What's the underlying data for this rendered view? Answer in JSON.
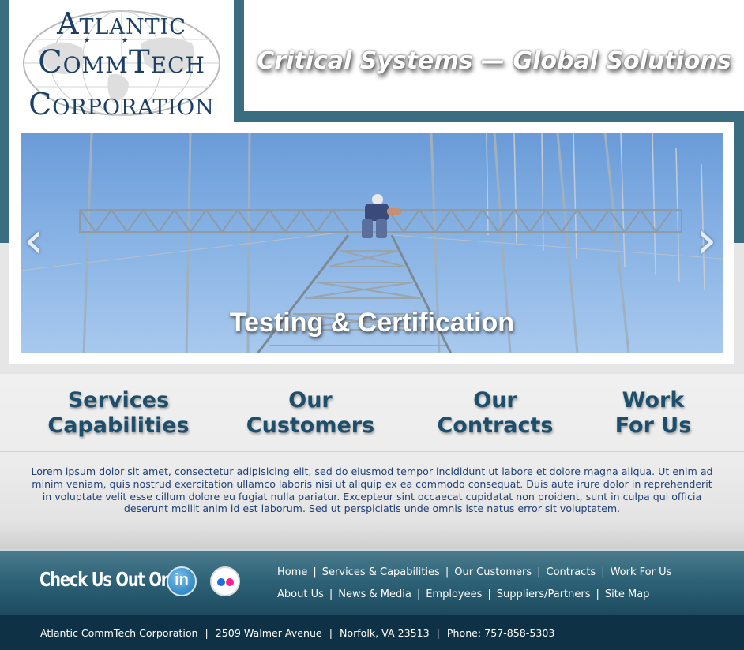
{
  "header": {
    "logo_line1": "Atlantic",
    "logo_line2": "CommTech",
    "logo_line3": "Corporation",
    "tagline": "Critical Systems — Global Solutions"
  },
  "slider": {
    "caption": "Testing & Certification",
    "prev_icon": "‹",
    "next_icon": "›"
  },
  "nav": {
    "items": [
      {
        "line1": "Services",
        "line2": "Capabilities"
      },
      {
        "line1": "Our",
        "line2": "Customers"
      },
      {
        "line1": "Our",
        "line2": "Contracts"
      },
      {
        "line1": "Work",
        "line2": "For Us"
      }
    ]
  },
  "intro_text": "Lorem ipsum dolor sit amet, consectetur adipisicing elit, sed do eiusmod tempor incididunt ut labore et dolore magna aliqua. Ut enim ad minim veniam, quis nostrud exercitation ullamco laboris nisi ut aliquip ex ea commodo consequat. Duis aute irure dolor in reprehenderit in voluptate velit esse cillum dolore eu fugiat nulla pariatur. Excepteur sint occaecat cupidatat non proident, sunt in culpa qui officia deserunt mollit anim id est laborum. Sed ut perspiciatis unde omnis iste natus error sit voluptatem.",
  "footer": {
    "check_us_out": "Check Us Out On:",
    "linkedin_label": "in",
    "links_row1": [
      "Home",
      "Services & Capabilities",
      "Our Customers",
      "Contracts",
      "Work For Us"
    ],
    "links_row2": [
      "About Us",
      "News & Media",
      "Employees",
      "Suppliers/Partners",
      "Site Map"
    ],
    "separator": "|"
  },
  "contact": {
    "company": "Atlantic CommTech Corporation",
    "street": "2509 Walmer Avenue",
    "city": "Norfolk, VA  23513",
    "phone": "Phone:  757-858-5303"
  },
  "colors": {
    "teal": "#3a6d80",
    "navy": "#1c3f66",
    "nav_text": "#1d4f6d",
    "bottom_bar": "#0e3146"
  }
}
